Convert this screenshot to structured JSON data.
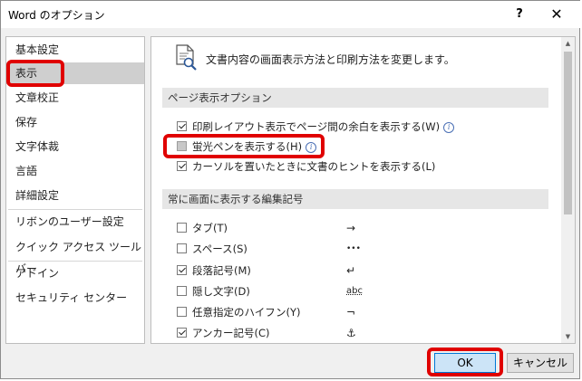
{
  "window": {
    "title": "Word のオプション",
    "help": "?",
    "close": "✕"
  },
  "sidebar": {
    "items": [
      {
        "label": "基本設定"
      },
      {
        "label": "表示"
      },
      {
        "label": "文章校正"
      },
      {
        "label": "保存"
      },
      {
        "label": "文字体裁"
      },
      {
        "label": "言語"
      },
      {
        "label": "詳細設定"
      },
      {
        "label": "リボンのユーザー設定"
      },
      {
        "label": "クイック アクセス ツール バー"
      },
      {
        "label": "アドイン"
      },
      {
        "label": "セキュリティ センター"
      }
    ],
    "selected": "表示"
  },
  "content": {
    "header": "文書内容の画面表示方法と印刷方法を変更します。",
    "page_section": {
      "title": "ページ表示オプション",
      "options": [
        {
          "label": "印刷レイアウト表示でページ間の余白を表示する(W)",
          "checked": true,
          "info": true
        },
        {
          "label": "蛍光ペンを表示する(H)",
          "checked": false,
          "info": true
        },
        {
          "label": "カーソルを置いたときに文書のヒントを表示する(L)",
          "checked": true,
          "info": false
        }
      ]
    },
    "marks_section": {
      "title": "常に画面に表示する編集記号",
      "options": [
        {
          "label": "タブ(T)",
          "checked": false,
          "mark": "→"
        },
        {
          "label": "スペース(S)",
          "checked": false,
          "mark": "•••"
        },
        {
          "label": "段落記号(M)",
          "checked": true,
          "mark": "↵"
        },
        {
          "label": "隠し文字(D)",
          "checked": false,
          "mark": "abc"
        },
        {
          "label": "任意指定のハイフン(Y)",
          "checked": false,
          "mark": "¬"
        },
        {
          "label": "アンカー記号(C)",
          "checked": true,
          "mark": "⚓"
        }
      ]
    }
  },
  "buttons": {
    "ok": "OK",
    "cancel": "キャンセル"
  }
}
